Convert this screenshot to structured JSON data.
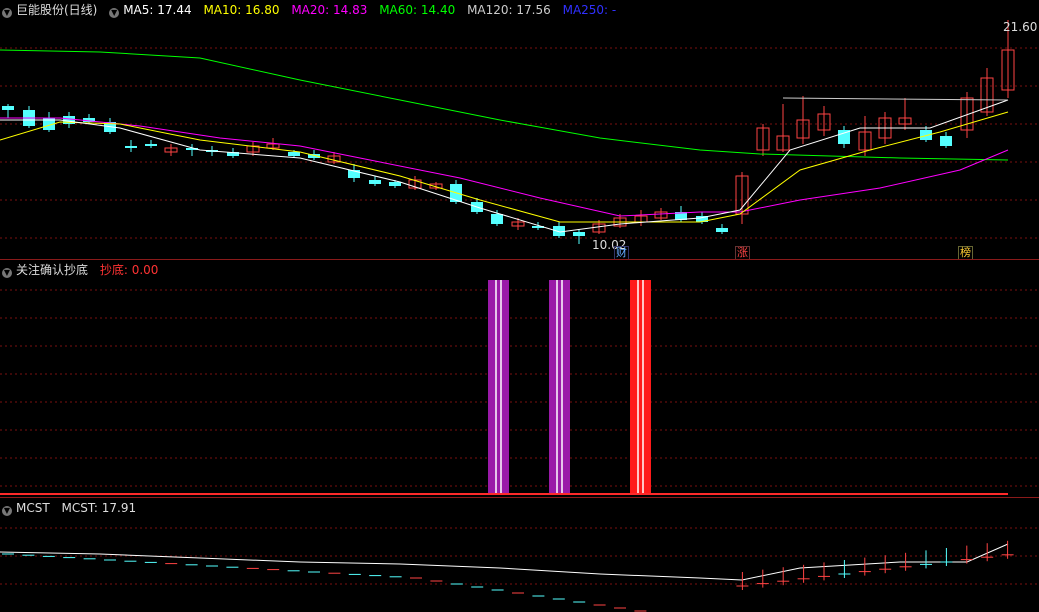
{
  "main": {
    "title": "巨能股份(日线)",
    "ma": [
      {
        "label": "MA5: 17.44",
        "color": "#ffffff"
      },
      {
        "label": "MA10: 16.80",
        "color": "#ffff00"
      },
      {
        "label": "MA20: 14.83",
        "color": "#ff00ff"
      },
      {
        "label": "MA60: 14.40",
        "color": "#00ff00"
      },
      {
        "label": "MA120: 17.56",
        "color": "#cccccc"
      },
      {
        "label": "MA250: -",
        "color": "#0000ff"
      }
    ],
    "high_label": "21.60",
    "low_label": "10.02",
    "markers": [
      {
        "text": "财",
        "color": "#66aaff"
      },
      {
        "text": "涨",
        "color": "#ff4444"
      },
      {
        "text": "榜",
        "color": "#ffcc33"
      }
    ]
  },
  "indicator": {
    "title": "关注确认抄底",
    "value_label": "抄底: 0.00",
    "value_color": "#ff3333"
  },
  "mcst": {
    "title": "MCST",
    "value_label": "MCST: 17.91"
  },
  "colors": {
    "up": "#ff4444",
    "down": "#54ffff",
    "grid": "#7a1010",
    "purple_bar": "#9a1aa8",
    "red_bar": "#ff1a1a"
  }
}
